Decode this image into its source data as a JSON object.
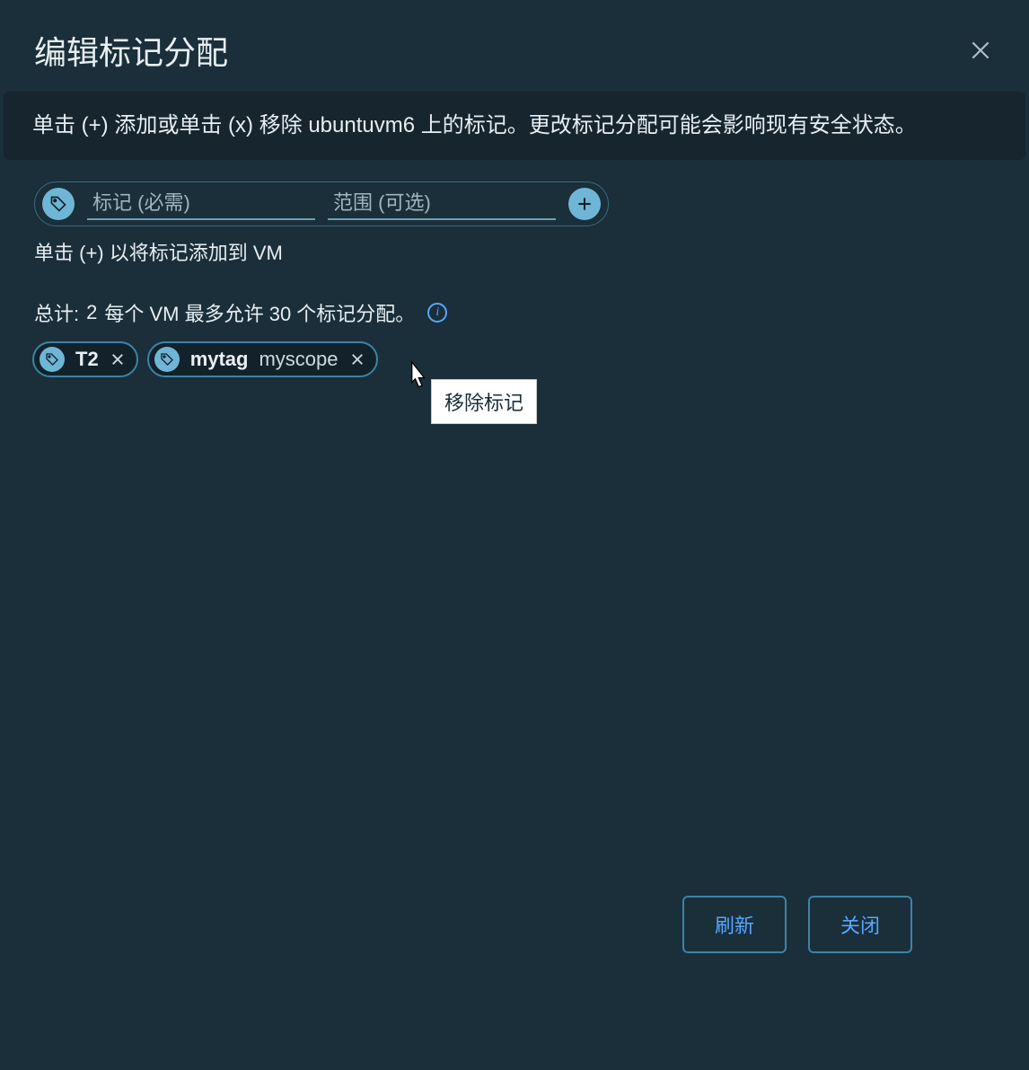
{
  "header": {
    "title": "编辑标记分配"
  },
  "banner": {
    "text": "单击 (+) 添加或单击 (x) 移除 ubuntuvm6 上的标记。更改标记分配可能会影响现有安全状态。"
  },
  "inputs": {
    "tag_placeholder": "标记 (必需)",
    "scope_placeholder": "范围 (可选)"
  },
  "hint": "单击 (+) 以将标记添加到 VM",
  "totals": {
    "label_prefix": "总计:",
    "count": "2",
    "label_suffix": "每个 VM 最多允许 30 个标记分配。"
  },
  "chips": [
    {
      "tag": "T2",
      "scope": ""
    },
    {
      "tag": "mytag",
      "scope": "myscope"
    }
  ],
  "tooltip": "移除标记",
  "footer": {
    "refresh": "刷新",
    "close": "关闭"
  }
}
